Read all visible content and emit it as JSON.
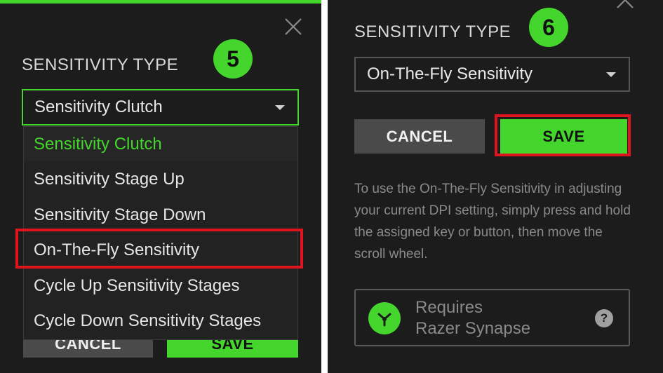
{
  "left_panel": {
    "section_title": "SENSITIVITY TYPE",
    "step_number": "5",
    "select_value": "Sensitivity Clutch",
    "dropdown_options": [
      "Sensitivity Clutch",
      "Sensitivity Stage Up",
      "Sensitivity Stage Down",
      "On-The-Fly Sensitivity",
      "Cycle Up Sensitivity Stages",
      "Cycle Down Sensitivity Stages"
    ],
    "cancel_label": "CANCEL",
    "save_label": "SAVE",
    "close_icon": "close-icon"
  },
  "right_panel": {
    "section_title": "SENSITIVITY TYPE",
    "step_number": "6",
    "select_value": "On-The-Fly Sensitivity",
    "cancel_label": "CANCEL",
    "save_label": "SAVE",
    "info_text": "To use the On-The-Fly Sensitivity in adjusting your current DPI setting, simply press and hold the assigned key or button, then move the scroll wheel.",
    "synapse_line1": "Requires",
    "synapse_line2": "Razer Synapse",
    "help_icon_text": "?",
    "close_icon": "close-icon"
  },
  "colors": {
    "accent_green": "#44d62c",
    "highlight_red": "#e0141e",
    "panel_bg": "#1c1c1c"
  }
}
